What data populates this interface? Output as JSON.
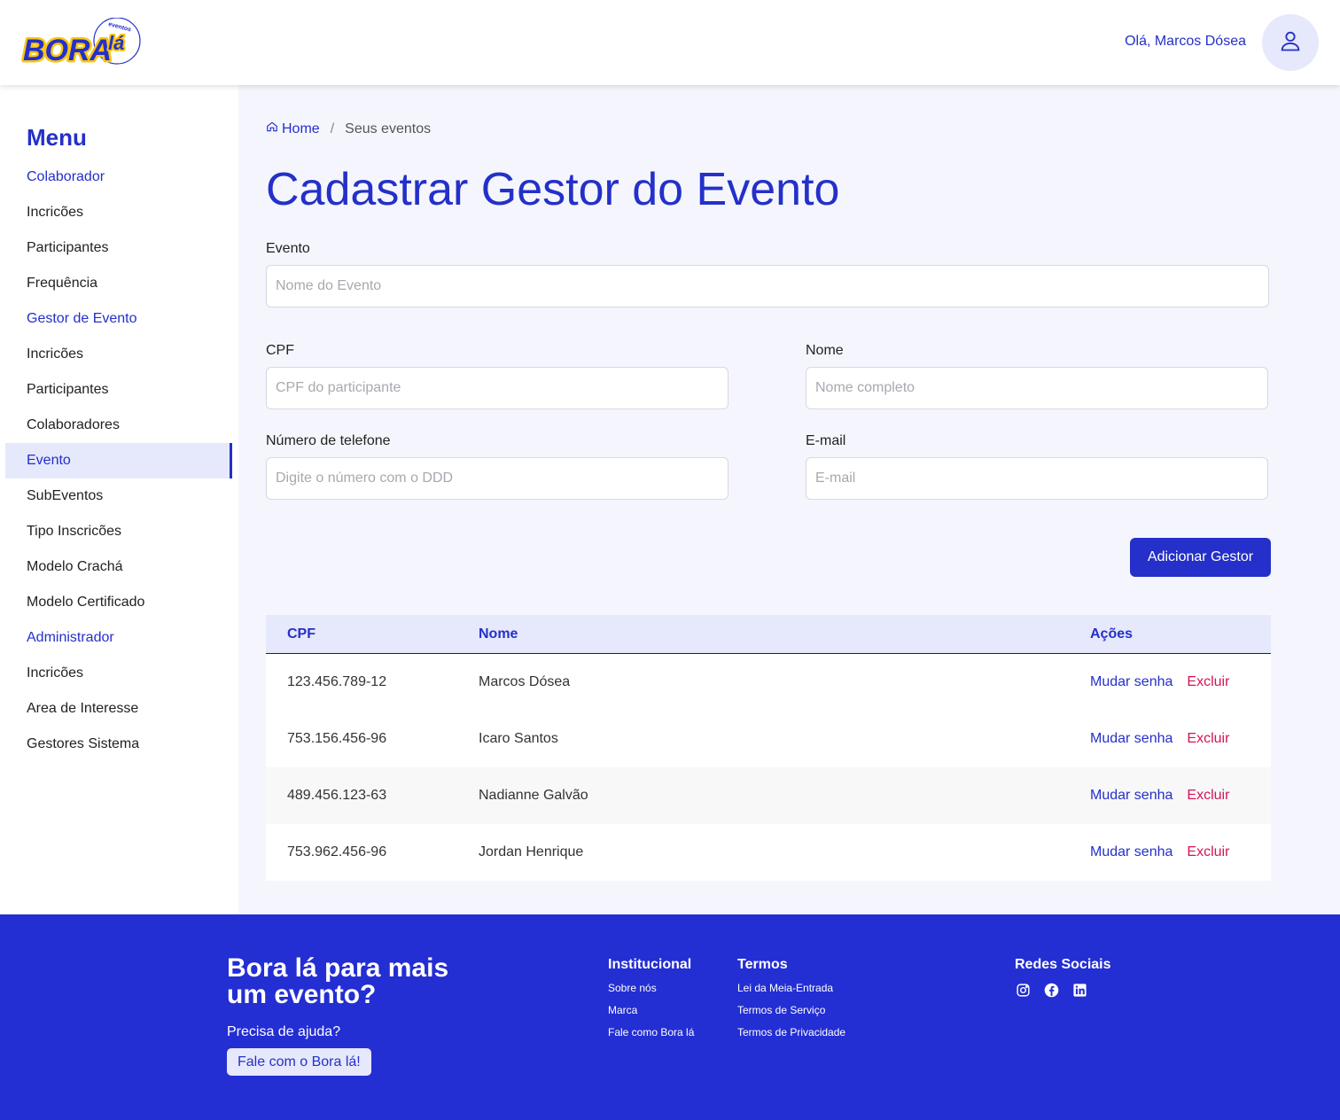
{
  "header": {
    "logo_text": "BORAlá",
    "logo_sub": "eventos",
    "greeting": "Olá, Marcos Dósea"
  },
  "sidebar": {
    "title": "Menu",
    "items": [
      {
        "label": "Colaborador",
        "type": "section"
      },
      {
        "label": "Incricões",
        "type": "item"
      },
      {
        "label": "Participantes",
        "type": "item"
      },
      {
        "label": "Frequência",
        "type": "item"
      },
      {
        "label": "Gestor de Evento",
        "type": "section"
      },
      {
        "label": "Incricões",
        "type": "item"
      },
      {
        "label": "Participantes",
        "type": "item"
      },
      {
        "label": "Colaboradores",
        "type": "item"
      },
      {
        "label": "Evento",
        "type": "active"
      },
      {
        "label": "SubEventos",
        "type": "item"
      },
      {
        "label": "Tipo Inscricões",
        "type": "item"
      },
      {
        "label": "Modelo Crachá",
        "type": "item"
      },
      {
        "label": "Modelo Certificado",
        "type": "item"
      },
      {
        "label": "Administrador",
        "type": "section"
      },
      {
        "label": "Incricões",
        "type": "item"
      },
      {
        "label": "Area de Interesse",
        "type": "item"
      },
      {
        "label": "Gestores Sistema",
        "type": "item"
      }
    ]
  },
  "breadcrumb": {
    "home": "Home",
    "current": "Seus eventos"
  },
  "page_title": "Cadastrar Gestor do Evento",
  "form": {
    "evento_label": "Evento",
    "evento_placeholder": "Nome do Evento",
    "cpf_label": "CPF",
    "cpf_placeholder": "CPF do participante",
    "nome_label": "Nome",
    "nome_placeholder": "Nome completo",
    "telefone_label": "Número de telefone",
    "telefone_placeholder": "Digite o número com o DDD",
    "email_label": "E-mail",
    "email_placeholder": "E-mail",
    "submit_label": "Adicionar Gestor"
  },
  "table": {
    "columns": [
      "CPF",
      "Nome",
      "Ações"
    ],
    "rows": [
      {
        "cpf": "123.456.789-12",
        "nome": "Marcos Dósea"
      },
      {
        "cpf": "753.156.456-96",
        "nome": "Icaro Santos"
      },
      {
        "cpf": "489.456.123-63",
        "nome": "Nadianne Galvão"
      },
      {
        "cpf": "753.962.456-96",
        "nome": "Jordan Henrique"
      }
    ],
    "action_change": "Mudar senha",
    "action_delete": "Excluir"
  },
  "footer": {
    "headline": "Bora lá para mais um evento?",
    "help_text": "Precisa de ajuda?",
    "help_button": "Fale com o Bora lá!",
    "institucional_title": "Institucional",
    "institucional_links": [
      "Sobre nós",
      "Marca",
      "Fale como Bora lá"
    ],
    "termos_title": "Termos",
    "termos_links": [
      "Lei da Meia-Entrada",
      "Termos de Serviço",
      "Termos de Privacidade"
    ],
    "social_title": "Redes Sociais",
    "social_icons": [
      "instagram-icon",
      "facebook-icon",
      "linkedin-icon"
    ]
  },
  "colors": {
    "primary": "#2430c9",
    "footer_bg": "#232ed3",
    "danger": "#d3145a",
    "accent_light": "#e6e8fb"
  }
}
